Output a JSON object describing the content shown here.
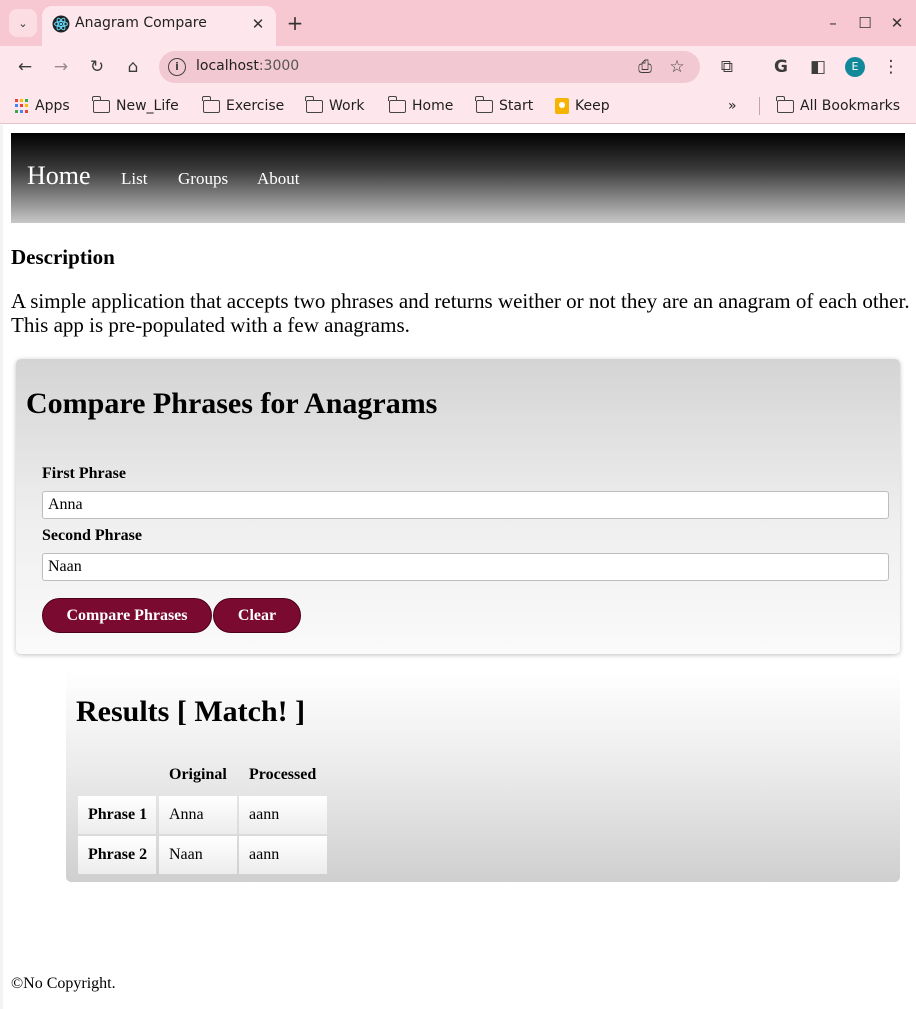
{
  "browser": {
    "tab_title": "Anagram Compare",
    "url_host": "localhost",
    "url_port": ":3000",
    "bookmarks": [
      "Apps",
      "New_Life",
      "Exercise",
      "Work",
      "Home",
      "Start",
      "Keep"
    ],
    "all_bookmarks": "All Bookmarks",
    "profile_initial": "E",
    "colors": {
      "tabbar": "#f8c8d2",
      "toolbar": "#fde7ec",
      "avatar": "#12899b"
    }
  },
  "nav": {
    "brand": "Home",
    "links": [
      "List",
      "Groups",
      "About"
    ]
  },
  "description": {
    "heading": "Description",
    "text": "A simple application that accepts two phrases and returns weither or not they are an anagram of each other. This app is pre-populated with a few anagrams."
  },
  "compare": {
    "heading": "Compare Phrases for Anagrams",
    "first_label": "First Phrase",
    "first_value": "Anna",
    "second_label": "Second Phrase",
    "second_value": "Naan",
    "compare_button": "Compare Phrases",
    "clear_button": "Clear",
    "button_color": "#7a0a2f"
  },
  "results": {
    "heading": "Results [ Match! ]",
    "columns": [
      "Original",
      "Processed"
    ],
    "rows": [
      {
        "label": "Phrase 1",
        "original": "Anna",
        "processed": "aann"
      },
      {
        "label": "Phrase 2",
        "original": "Naan",
        "processed": "aann"
      }
    ]
  },
  "footer": "©No Copyright."
}
